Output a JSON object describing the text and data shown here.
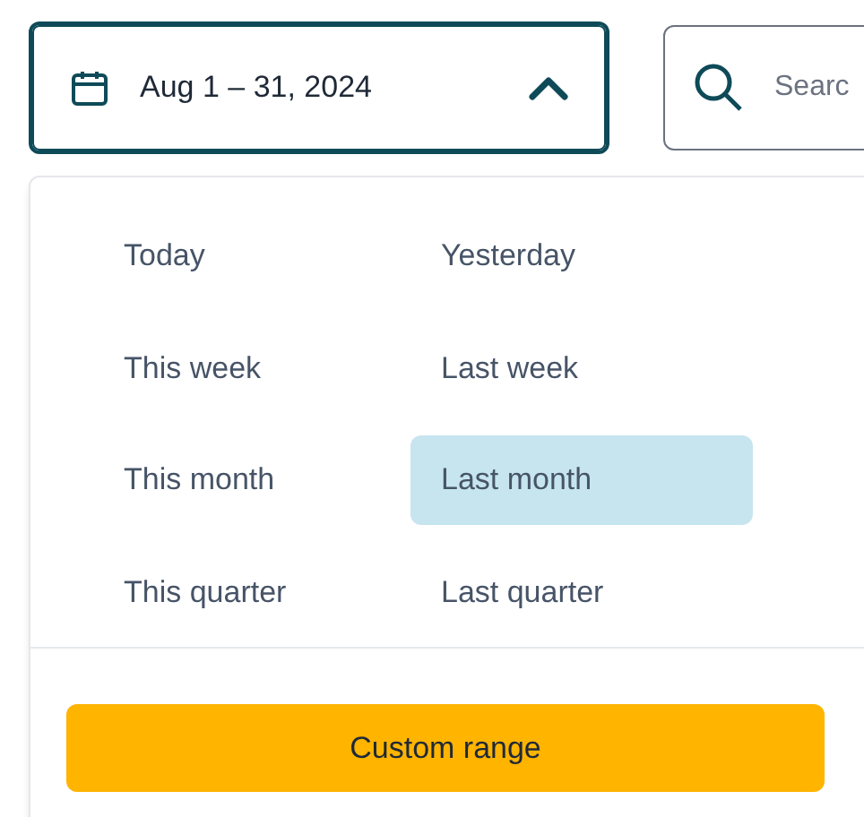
{
  "date_picker": {
    "value": "Aug 1 – 31, 2024",
    "expanded": true
  },
  "search": {
    "placeholder": "Searc"
  },
  "presets": [
    {
      "label": "Today",
      "selected": false
    },
    {
      "label": "Yesterday",
      "selected": false
    },
    {
      "label": "This week",
      "selected": false
    },
    {
      "label": "Last week",
      "selected": false
    },
    {
      "label": "This month",
      "selected": false
    },
    {
      "label": "Last month",
      "selected": true
    },
    {
      "label": "This quarter",
      "selected": false
    },
    {
      "label": "Last quarter",
      "selected": false
    }
  ],
  "custom_button": "Custom range"
}
